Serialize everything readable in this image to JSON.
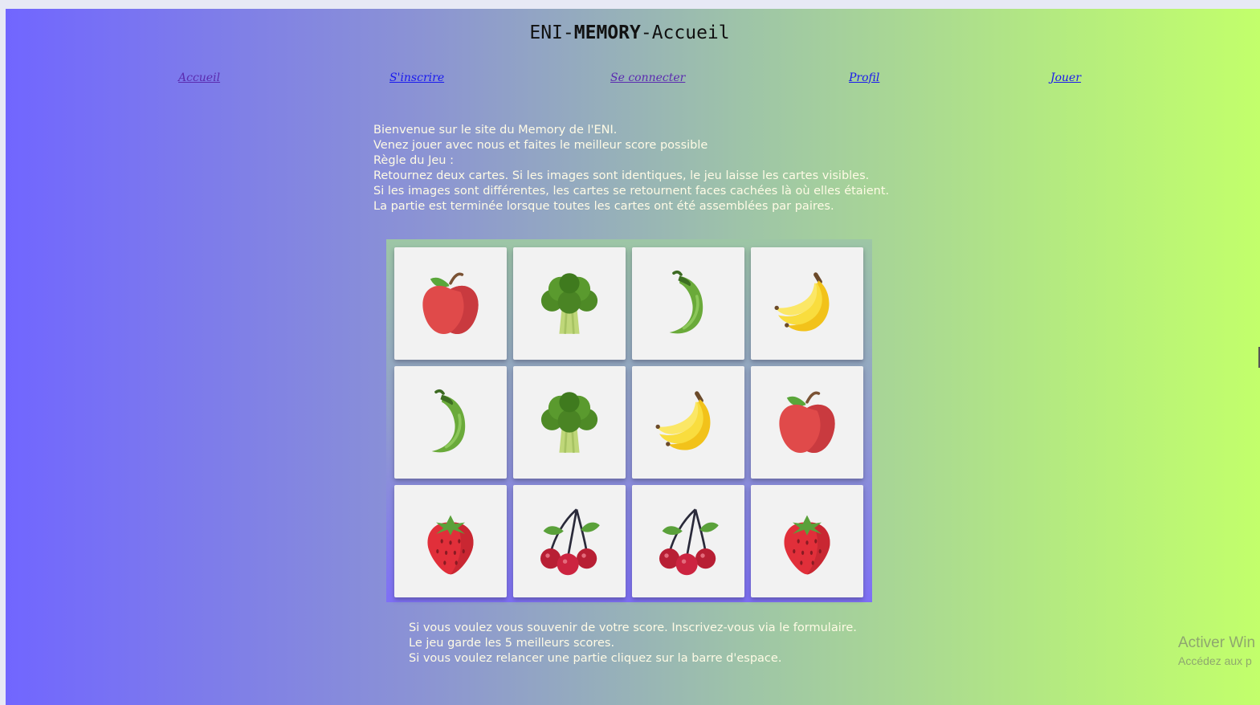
{
  "header": {
    "title_prefix": "ENI-",
    "title_bold": "MEMORY",
    "title_suffix": "-Accueil"
  },
  "nav": {
    "items": [
      {
        "label": "Accueil"
      },
      {
        "label": "S'inscrire"
      },
      {
        "label": "Se connecter"
      },
      {
        "label": "Profil"
      },
      {
        "label": "Jouer"
      }
    ]
  },
  "intro": {
    "lines": [
      "Bienvenue sur le site du Memory de l'ENI.",
      "Venez jouer avec nous et faites le meilleur score possible",
      "Règle du Jeu :",
      "Retournez deux cartes. Si les images sont identiques, le jeu laisse les cartes visibles.",
      "Si les images sont différentes, les cartes se retournent faces cachées là où elles étaient.",
      "La partie est terminée lorsque toutes les cartes ont été assemblées par paires."
    ]
  },
  "board": {
    "cards": [
      {
        "icon": "apple-icon"
      },
      {
        "icon": "broccoli-icon"
      },
      {
        "icon": "chili-pepper-icon"
      },
      {
        "icon": "banana-icon"
      },
      {
        "icon": "chili-pepper-icon"
      },
      {
        "icon": "broccoli-icon"
      },
      {
        "icon": "banana-icon"
      },
      {
        "icon": "apple-icon"
      },
      {
        "icon": "strawberry-icon"
      },
      {
        "icon": "cherries-icon"
      },
      {
        "icon": "cherries-icon"
      },
      {
        "icon": "strawberry-icon"
      }
    ]
  },
  "outro": {
    "lines": [
      "Si vous voulez vous souvenir de votre score. Inscrivez-vous via le formulaire.",
      "Le jeu garde les 5 meilleurs scores.",
      "Si vous voulez relancer une partie cliquez sur la barre d'espace."
    ]
  },
  "watermark": {
    "line1": "Activer Win",
    "line2": "Accédez aux p"
  },
  "colors": {
    "gradient_start": "#7166ff",
    "gradient_end": "#c2ff6b",
    "card_face": "#f2f2f2",
    "text_light": "#fffbe5"
  }
}
